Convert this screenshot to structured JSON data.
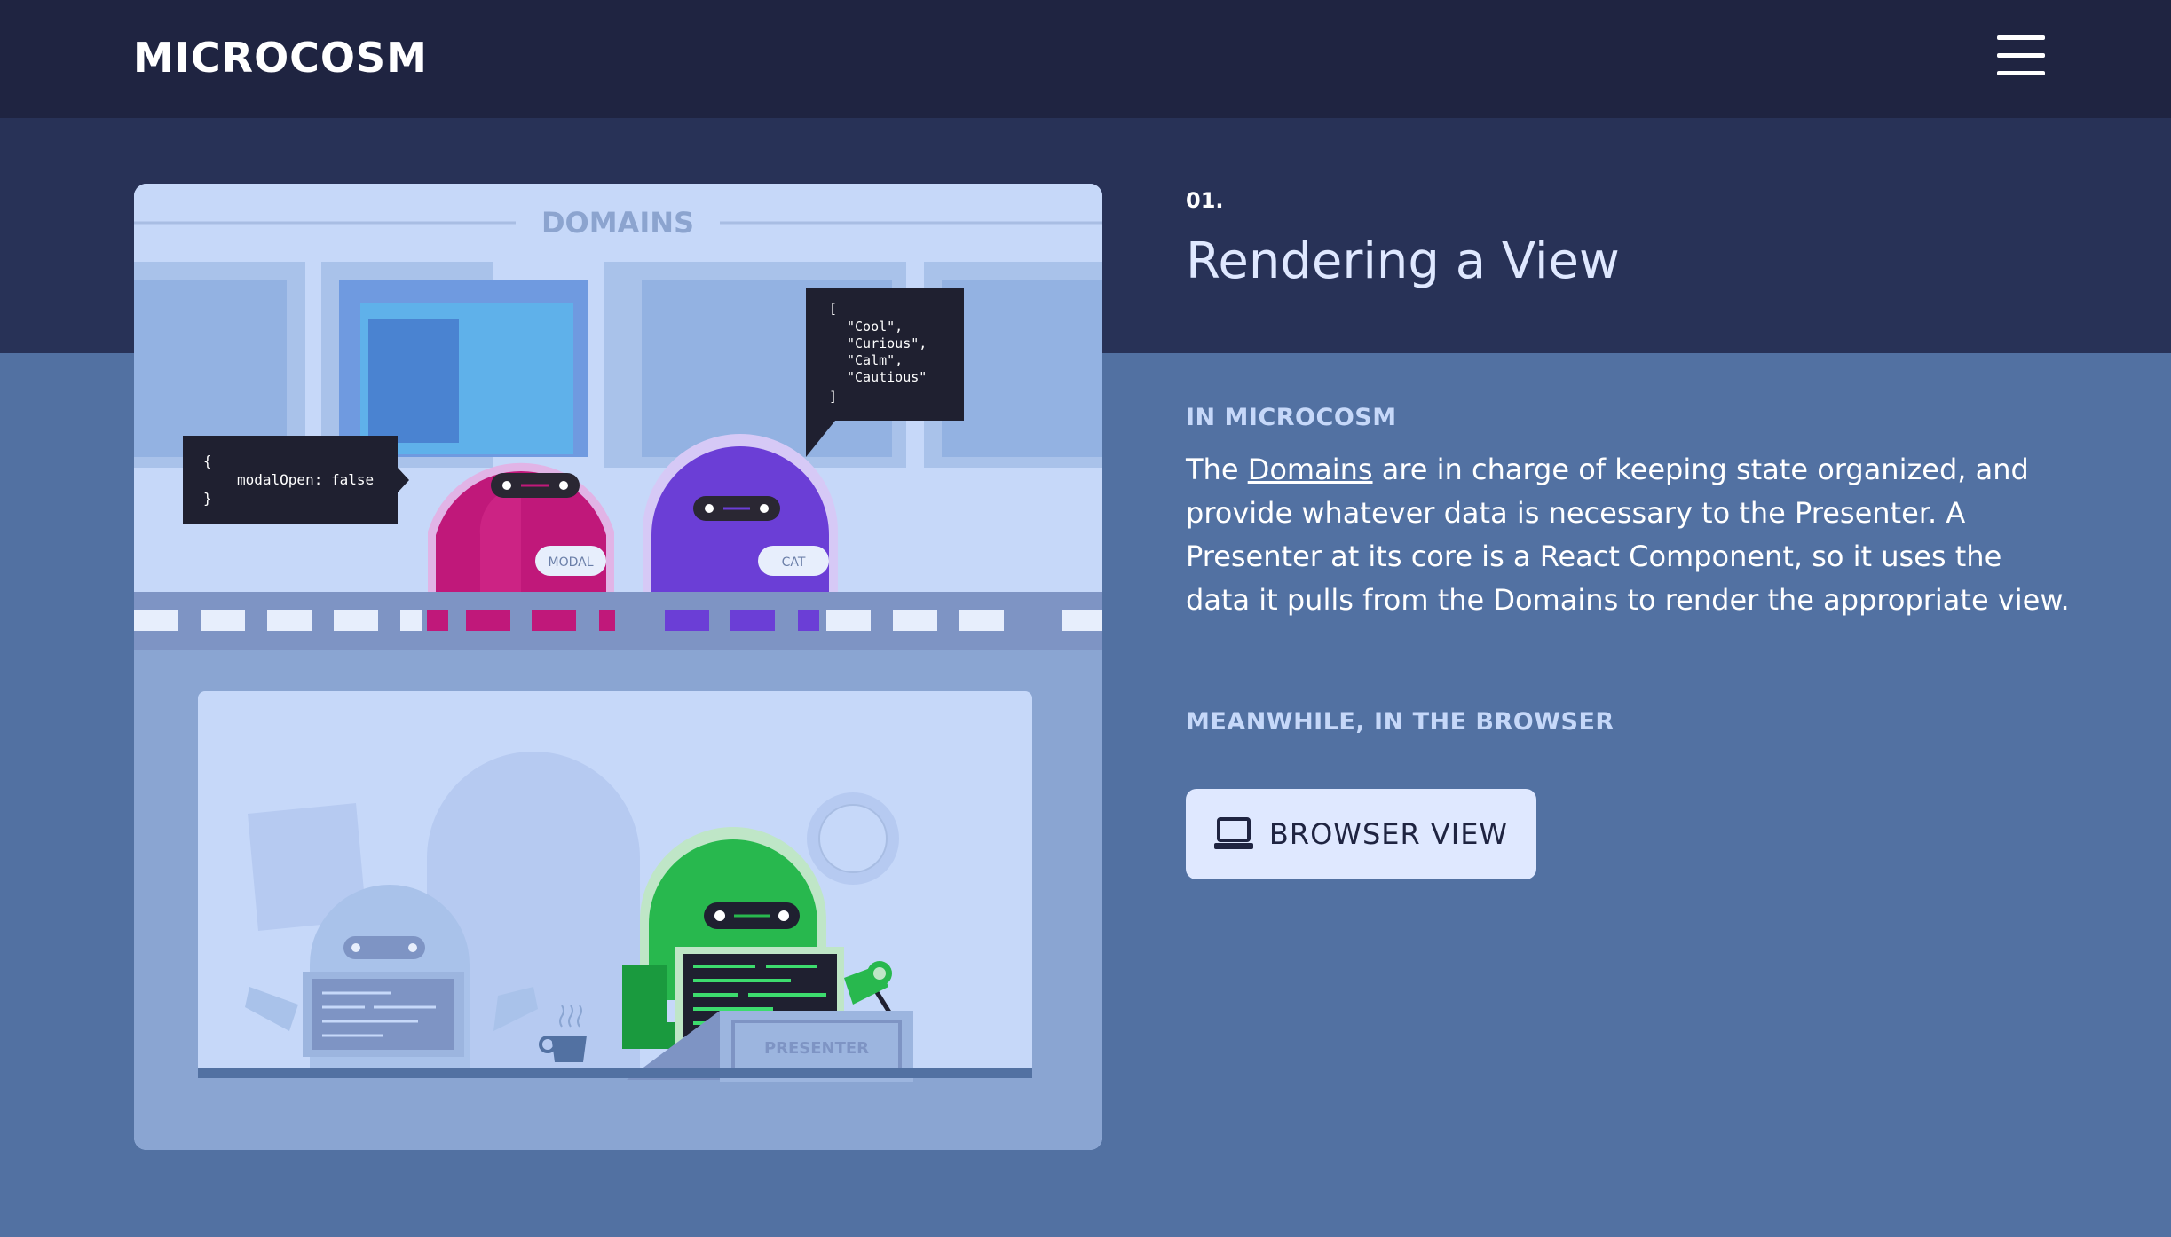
{
  "header": {
    "logo": "MICROCOSM",
    "menu_icon": "hamburger-menu-icon"
  },
  "illustration": {
    "domains_heading": "DOMAINS",
    "modal_bubble": {
      "open_brace": "{",
      "code": "modalOpen: false",
      "close_brace": "}"
    },
    "cat_bubble": {
      "open_bracket": "[",
      "items": [
        "\"Cool\",",
        "\"Curious\",",
        "\"Calm\",",
        "\"Cautious\""
      ],
      "close_bracket": "]"
    },
    "modal_label": "MODAL",
    "cat_label": "CAT",
    "presenter_label": "PRESENTER",
    "colors": {
      "modal_robot": "#c0187a",
      "cat_robot": "#6b3ed6",
      "presenter_robot": "#28b84e"
    }
  },
  "content": {
    "step": "01.",
    "title": "Rendering a View",
    "section1_label": "IN MICROCOSM",
    "body_before_link": "The ",
    "body_link": "Domains",
    "body_after_link": " are in charge of keeping state organized, and provide whatever data is necessary to the Presenter. A Presenter at its core is a React Component, so it uses the data it pulls from the Domains to render the appropriate view.",
    "section2_label": "MEANWHILE, IN THE BROWSER",
    "button_label": "BROWSER VIEW",
    "button_icon": "laptop-icon"
  }
}
